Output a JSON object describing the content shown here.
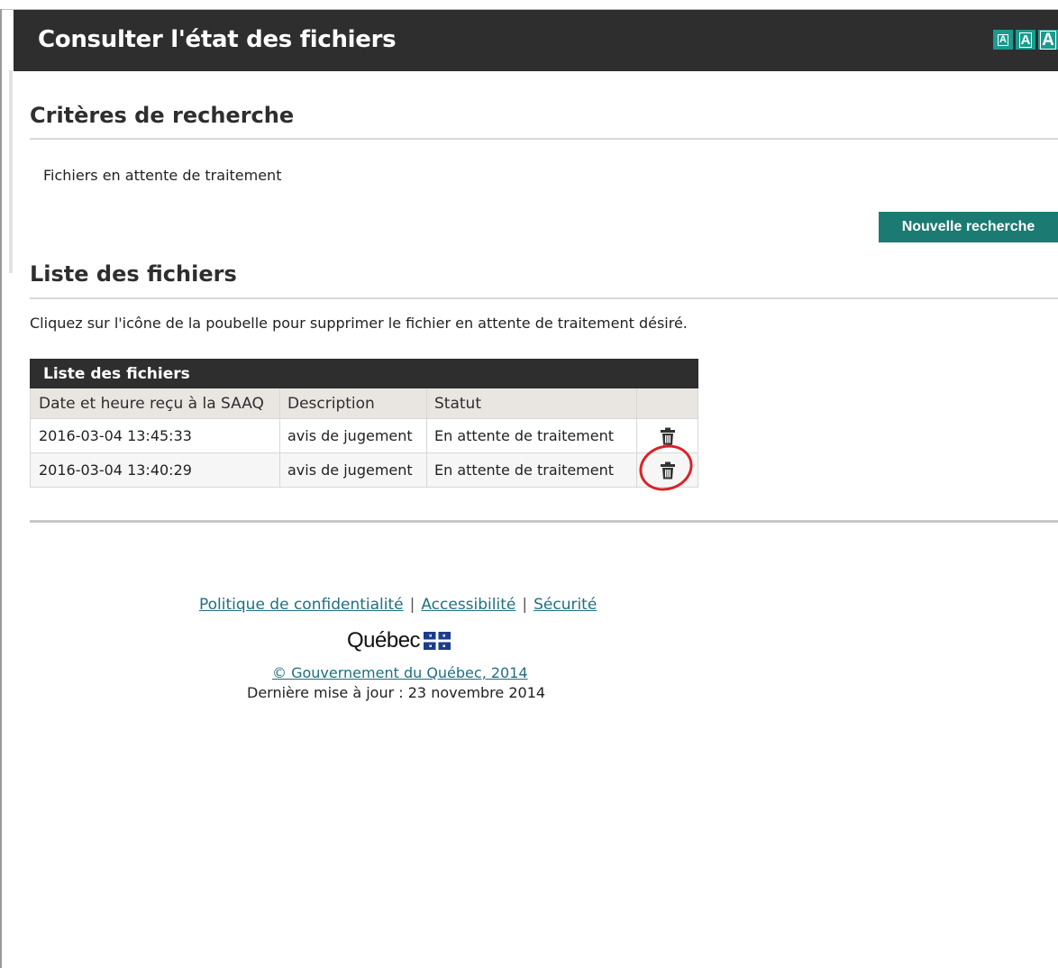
{
  "header": {
    "title": "Consulter l'état des fichiers",
    "font_size_buttons": [
      "A",
      "A",
      "A"
    ],
    "accent_color": "#1a9b8e"
  },
  "criteria": {
    "title": "Critères de recherche",
    "text": "Fichiers en attente de traitement",
    "new_search_label": "Nouvelle recherche"
  },
  "files": {
    "title": "Liste des fichiers",
    "instructions": "Cliquez sur l'icône de la poubelle pour supprimer le fichier en attente de traitement désiré.",
    "table": {
      "caption": "Liste des fichiers",
      "columns": [
        "Date et heure reçu à la SAAQ",
        "Description",
        "Statut",
        ""
      ],
      "rows": [
        {
          "date": "2016-03-04 13:45:33",
          "description": "avis de jugement",
          "status": "En attente de traitement",
          "action_icon": "trash-icon"
        },
        {
          "date": "2016-03-04 13:40:29",
          "description": "avis de jugement",
          "status": "En attente de traitement",
          "action_icon": "trash-icon"
        }
      ]
    }
  },
  "footer": {
    "links": [
      "Politique de confidentialité",
      "Accessibilité",
      "Sécurité"
    ],
    "separator": "|",
    "logo_word": "Québec",
    "copyright": "© Gouvernement du Québec, 2014",
    "updated": "Dernière mise à jour : 23 novembre 2014"
  }
}
